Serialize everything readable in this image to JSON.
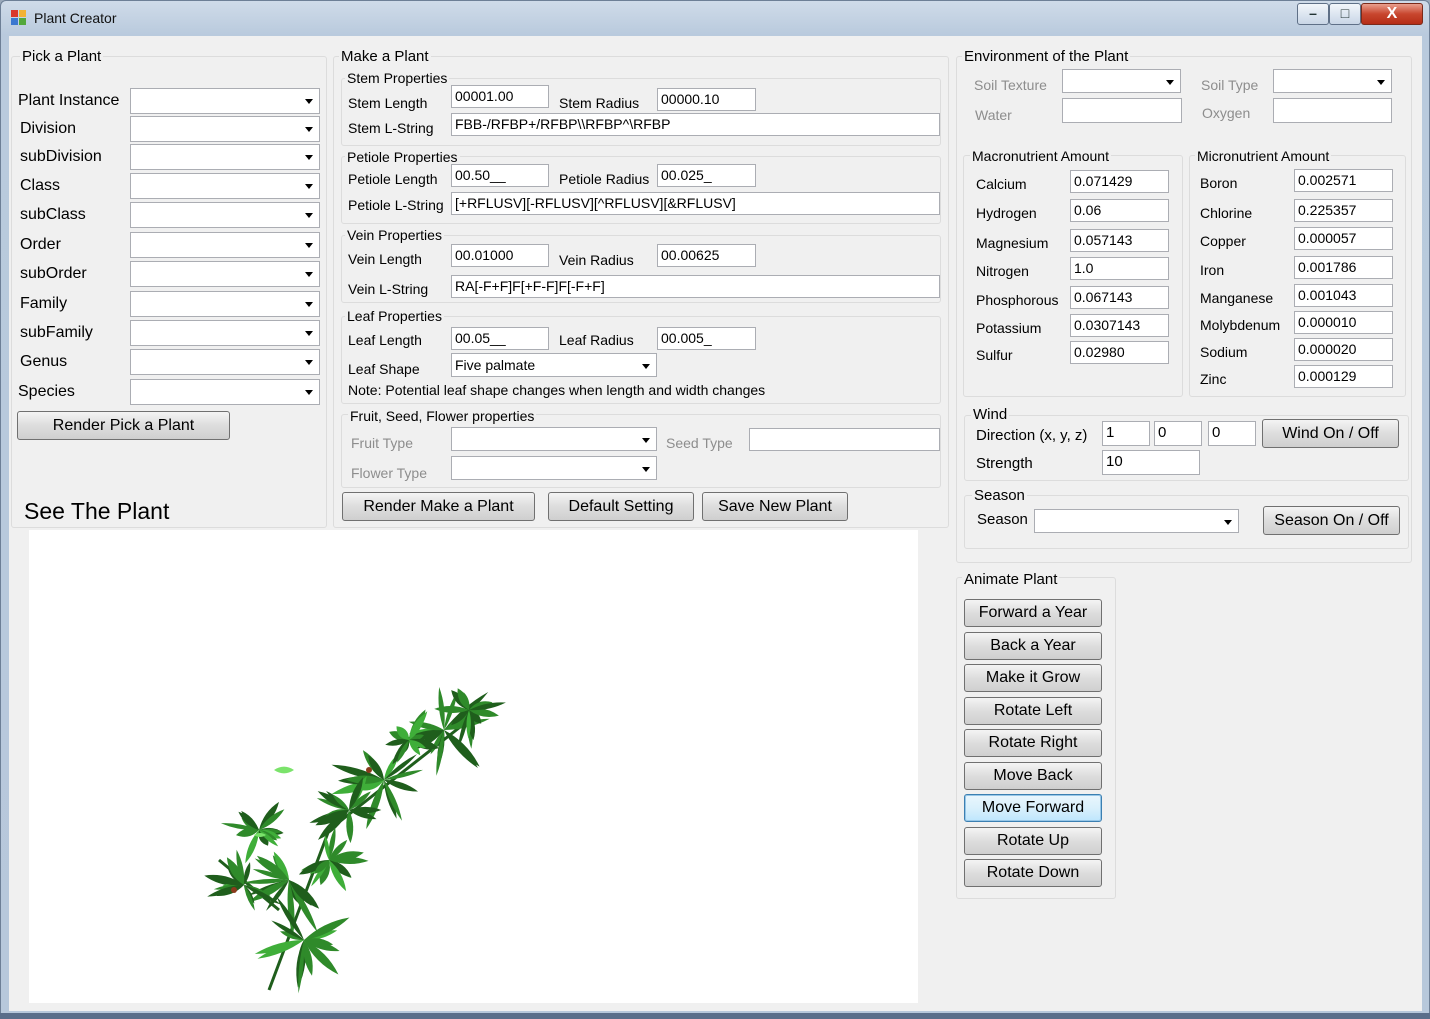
{
  "window": {
    "title": "Plant Creator",
    "minimize_glyph": "–",
    "maximize_glyph": "□",
    "close_glyph": "X"
  },
  "colors": {
    "leaf_dark": "#1f5e1c",
    "leaf_mid": "#2f8a2a",
    "leaf_light": "#3fae39",
    "leaf_highlight": "#7be36b",
    "stem": "#8b3a1c"
  },
  "pick": {
    "title": "Pick a Plant",
    "fields": [
      {
        "label": "Plant Instance",
        "value": ""
      },
      {
        "label": "Division",
        "value": ""
      },
      {
        "label": "subDivision",
        "value": ""
      },
      {
        "label": "Class",
        "value": ""
      },
      {
        "label": "subClass",
        "value": ""
      },
      {
        "label": "Order",
        "value": ""
      },
      {
        "label": "subOrder",
        "value": ""
      },
      {
        "label": "Family",
        "value": ""
      },
      {
        "label": "subFamily",
        "value": ""
      },
      {
        "label": "Genus",
        "value": ""
      },
      {
        "label": "Species",
        "value": ""
      }
    ],
    "render_button": "Render Pick a Plant"
  },
  "see_plant": {
    "title": "See The Plant"
  },
  "make": {
    "title": "Make a Plant",
    "stem": {
      "title": "Stem Properties",
      "length_label": "Stem Length",
      "length": "00001.00",
      "radius_label": "Stem Radius",
      "radius": "00000.10",
      "lstring_label": "Stem L-String",
      "lstring": "FBB-/RFBP+/RFBP\\\\RFBP^\\RFBP"
    },
    "petiole": {
      "title": "Petiole Properties",
      "length_label": "Petiole Length",
      "length": "00.50__",
      "radius_label": "Petiole Radius",
      "radius": "00.025_",
      "lstring_label": "Petiole L-String",
      "lstring": "[+RFLUSV][-RFLUSV][^RFLUSV][&RFLUSV]"
    },
    "vein": {
      "title": "Vein Properties",
      "length_label": "Vein Length",
      "length": "00.01000",
      "radius_label": "Vein Radius",
      "radius": "00.00625",
      "lstring_label": "Vein L-String",
      "lstring": "RA[-F+F]F[+F-F]F[-F+F]"
    },
    "leaf": {
      "title": "Leaf Properties",
      "length_label": "Leaf Length",
      "length": "00.05__",
      "radius_label": "Leaf Radius",
      "radius": "00.005_",
      "shape_label": "Leaf Shape",
      "shape": "Five palmate",
      "note": "Note: Potential leaf shape changes when length and width changes"
    },
    "fruit": {
      "title": "Fruit, Seed, Flower properties",
      "fruit_label": "Fruit Type",
      "fruit": "",
      "seed_label": "Seed Type",
      "seed": "",
      "flower_label": "Flower Type",
      "flower": ""
    },
    "buttons": {
      "render": "Render Make a Plant",
      "default": "Default Setting",
      "save": "Save New Plant"
    }
  },
  "env": {
    "title": "Environment of the Plant",
    "soil_texture_label": "Soil Texture",
    "soil_texture": "",
    "soil_type_label": "Soil Type",
    "soil_type": "",
    "water_label": "Water",
    "water": "",
    "oxygen_label": "Oxygen",
    "oxygen": "",
    "macro": {
      "title": "Macronutrient Amount",
      "items": [
        {
          "label": "Calcium",
          "value": "0.071429"
        },
        {
          "label": "Hydrogen",
          "value": "0.06"
        },
        {
          "label": "Magnesium",
          "value": "0.057143"
        },
        {
          "label": "Nitrogen",
          "value": "1.0"
        },
        {
          "label": "Phosphorous",
          "value": "0.067143"
        },
        {
          "label": "Potassium",
          "value": "0.0307143"
        },
        {
          "label": "Sulfur",
          "value": "0.02980"
        }
      ]
    },
    "micro": {
      "title": "Micronutrient Amount",
      "items": [
        {
          "label": "Boron",
          "value": "0.002571"
        },
        {
          "label": "Chlorine",
          "value": "0.225357"
        },
        {
          "label": "Copper",
          "value": "0.000057"
        },
        {
          "label": "Iron",
          "value": "0.001786"
        },
        {
          "label": "Manganese",
          "value": "0.001043"
        },
        {
          "label": "Molybdenum",
          "value": "0.000010"
        },
        {
          "label": "Sodium",
          "value": "0.000020"
        },
        {
          "label": "Zinc",
          "value": "0.000129"
        }
      ]
    },
    "wind": {
      "title": "Wind",
      "direction_label": "Direction (x, y, z)",
      "x": "1",
      "y": "0",
      "z": "0",
      "strength_label": "Strength",
      "strength": "10",
      "toggle": "Wind On / Off"
    },
    "season": {
      "title": "Season",
      "label": "Season",
      "value": "",
      "toggle": "Season On / Off"
    }
  },
  "animate": {
    "title": "Animate Plant",
    "buttons": [
      "Forward a Year",
      "Back a Year",
      "Make it Grow",
      "Rotate Left",
      "Rotate Right",
      "Move Back",
      "Move Forward",
      "Rotate Up",
      "Rotate Down"
    ]
  }
}
